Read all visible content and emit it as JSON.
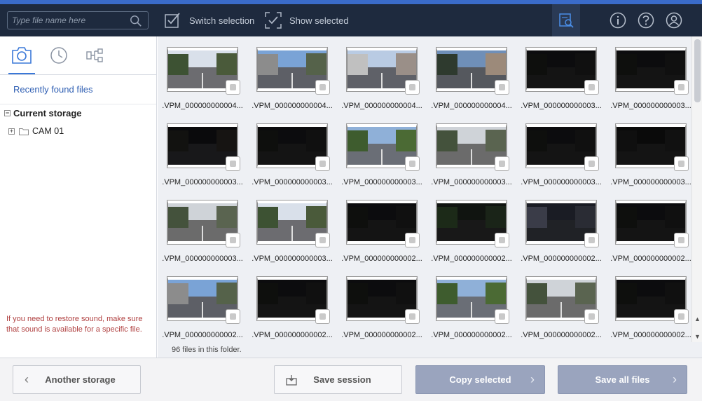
{
  "topbar": {
    "search_placeholder": "Type file name here",
    "switch_selection_label": "Switch selection",
    "show_selected_label": "Show selected"
  },
  "sidebar": {
    "recently_found_label": "Recently found files",
    "current_storage_label": "Current storage",
    "tree_child_label": "CAM 01",
    "note": "If you need to restore sound, make sure that sound is available for a specific file."
  },
  "grid": {
    "files_count_text": "96 files in this folder.",
    "items": [
      {
        "name": ".VPM_000000000004...",
        "scene": "day"
      },
      {
        "name": ".VPM_000000000004...",
        "scene": "daybright"
      },
      {
        "name": ".VPM_000000000004...",
        "scene": "daycity"
      },
      {
        "name": ".VPM_000000000004...",
        "scene": "daytunnel"
      },
      {
        "name": ".VPM_000000000003...",
        "scene": "night"
      },
      {
        "name": ".VPM_000000000003...",
        "scene": "night"
      },
      {
        "name": ".VPM_000000000003...",
        "scene": "nightlight"
      },
      {
        "name": ".VPM_000000000003...",
        "scene": "night"
      },
      {
        "name": ".VPM_000000000003...",
        "scene": "daygreen"
      },
      {
        "name": ".VPM_000000000003...",
        "scene": "daygrey"
      },
      {
        "name": ".VPM_000000000003...",
        "scene": "night"
      },
      {
        "name": ".VPM_000000000003...",
        "scene": "nightred"
      },
      {
        "name": ".VPM_000000000003...",
        "scene": "daygrey"
      },
      {
        "name": ".VPM_000000000003...",
        "scene": "day"
      },
      {
        "name": ".VPM_000000000002...",
        "scene": "night"
      },
      {
        "name": ".VPM_000000000002...",
        "scene": "nighttree"
      },
      {
        "name": ".VPM_000000000002...",
        "scene": "nightcity"
      },
      {
        "name": ".VPM_000000000002...",
        "scene": "night"
      },
      {
        "name": ".VPM_000000000002...",
        "scene": "daybright"
      },
      {
        "name": ".VPM_000000000002...",
        "scene": "night"
      },
      {
        "name": ".VPM_000000000002...",
        "scene": "night"
      },
      {
        "name": ".VPM_000000000002...",
        "scene": "daygreen"
      },
      {
        "name": ".VPM_000000000002...",
        "scene": "daygrey"
      },
      {
        "name": ".VPM_000000000002...",
        "scene": "night"
      }
    ]
  },
  "bottombar": {
    "another_storage_label": "Another storage",
    "save_session_label": "Save session",
    "copy_selected_label": "Copy selected",
    "save_all_label": "Save all files"
  },
  "colors": {
    "topbar_bg": "#1e2a3e",
    "accent": "#3a78d8",
    "button_blue": "#9aa4be",
    "note_red": "#b04040"
  }
}
